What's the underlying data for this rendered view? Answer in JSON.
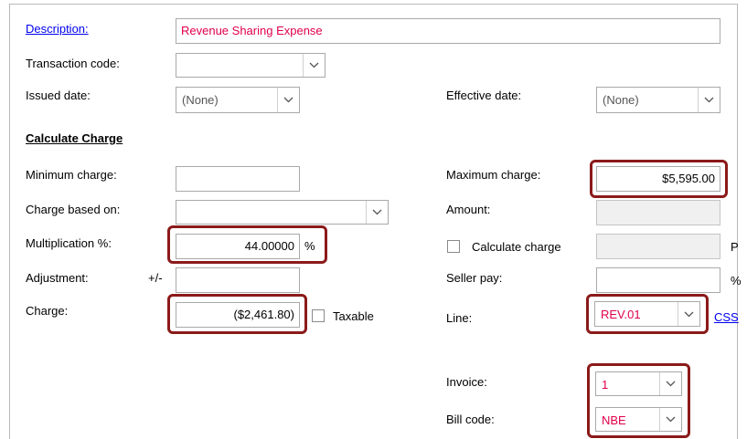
{
  "form": {
    "description": {
      "label": "Description:",
      "value": "Revenue Sharing Expense"
    },
    "transaction_code": {
      "label": "Transaction code:",
      "value": ""
    },
    "issued_date": {
      "label": "Issued date:",
      "value": "(None)"
    },
    "effective_date": {
      "label": "Effective date:",
      "value": "(None)"
    },
    "calculate_charge": {
      "title": "Calculate Charge",
      "minimum_charge": {
        "label": "Minimum charge:",
        "value": ""
      },
      "charge_based_on": {
        "label": "Charge based on:",
        "value": ""
      },
      "multiplication_pct": {
        "label": "Multiplication %:",
        "value": "44.00000",
        "suffix": "%"
      },
      "adjustment": {
        "label": "Adjustment:",
        "sign": "+/-",
        "value": ""
      },
      "charge": {
        "label": "Charge:",
        "value": "($2,461.80)"
      },
      "taxable": {
        "label": "Taxable",
        "checked": false
      },
      "maximum_charge": {
        "label": "Maximum charge:",
        "value": "$5,595.00"
      },
      "amount": {
        "label": "Amount:",
        "value": ""
      },
      "calculate_charge_toggle": {
        "label": "Calculate charge",
        "checked": false,
        "suffix": "P"
      },
      "seller_pay": {
        "label": "Seller pay:",
        "value": "",
        "suffix": "%"
      },
      "line": {
        "label": "Line:",
        "value": "REV.01",
        "link": "CSS"
      },
      "invoice": {
        "label": "Invoice:",
        "value": "1"
      },
      "bill_code": {
        "label": "Bill code:",
        "value": "NBE"
      }
    }
  },
  "icons": {
    "dropdown": "chevron-down-icon",
    "checkbox": "checkbox-icon"
  },
  "colors": {
    "link": "#0000ee",
    "value_text": "#e0004a",
    "highlight": "#8b1a1a",
    "readonly_bg": "#f0f0f0"
  }
}
